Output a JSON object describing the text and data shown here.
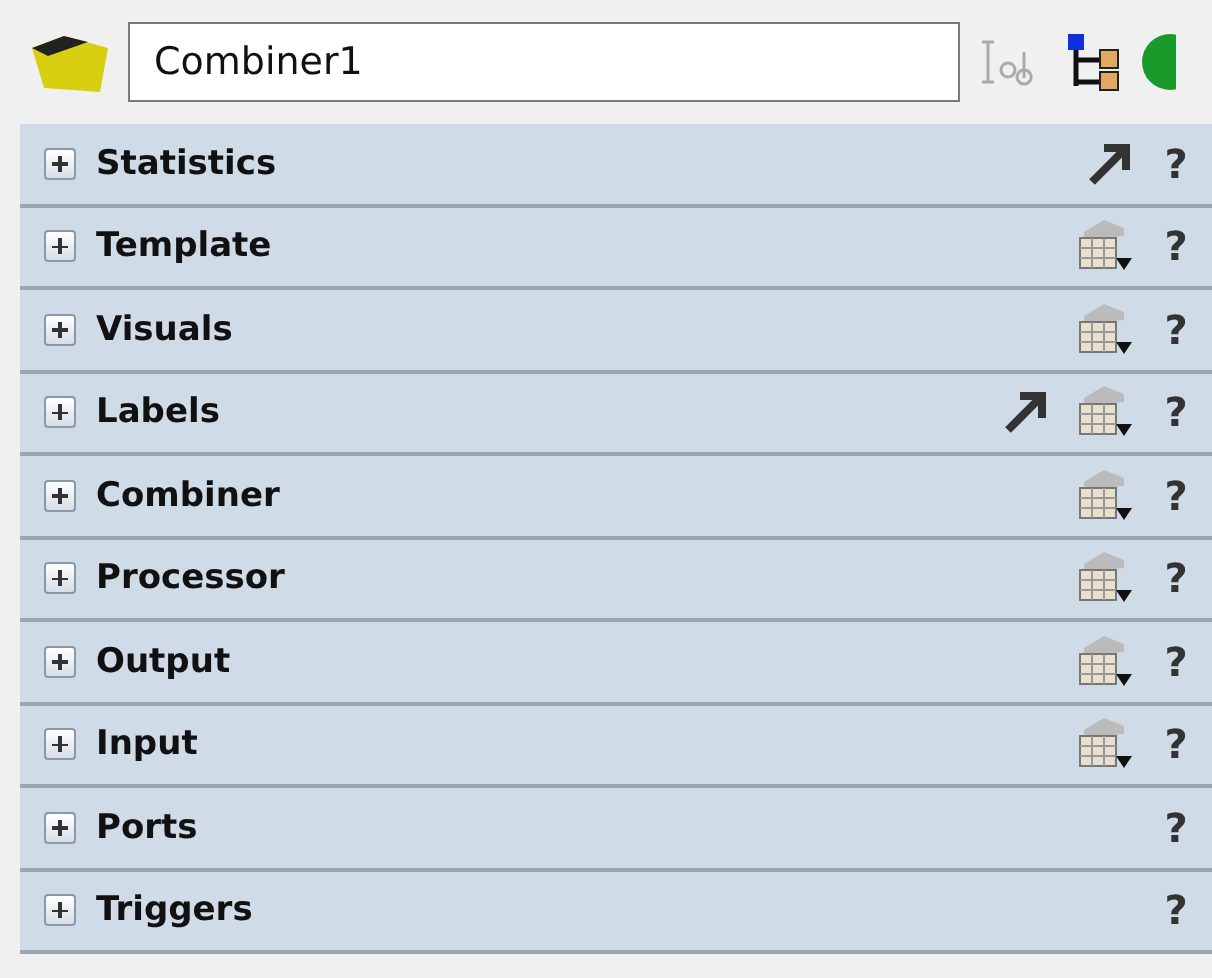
{
  "name_field": {
    "value": "Combiner1"
  },
  "sections": [
    {
      "title": "Statistics",
      "expanded": false,
      "pointer": true,
      "table_menu": false,
      "help": "?"
    },
    {
      "title": "Template",
      "expanded": false,
      "pointer": false,
      "table_menu": true,
      "help": "?"
    },
    {
      "title": "Visuals",
      "expanded": false,
      "pointer": false,
      "table_menu": true,
      "help": "?"
    },
    {
      "title": "Labels",
      "expanded": false,
      "pointer": true,
      "table_menu": true,
      "help": "?"
    },
    {
      "title": "Combiner",
      "expanded": false,
      "pointer": false,
      "table_menu": true,
      "help": "?"
    },
    {
      "title": "Processor",
      "expanded": false,
      "pointer": false,
      "table_menu": true,
      "help": "?"
    },
    {
      "title": "Output",
      "expanded": false,
      "pointer": false,
      "table_menu": true,
      "help": "?"
    },
    {
      "title": "Input",
      "expanded": false,
      "pointer": false,
      "table_menu": true,
      "help": "?"
    },
    {
      "title": "Ports",
      "expanded": false,
      "pointer": false,
      "table_menu": false,
      "help": "?"
    },
    {
      "title": "Triggers",
      "expanded": false,
      "pointer": false,
      "table_menu": false,
      "help": "?"
    }
  ]
}
